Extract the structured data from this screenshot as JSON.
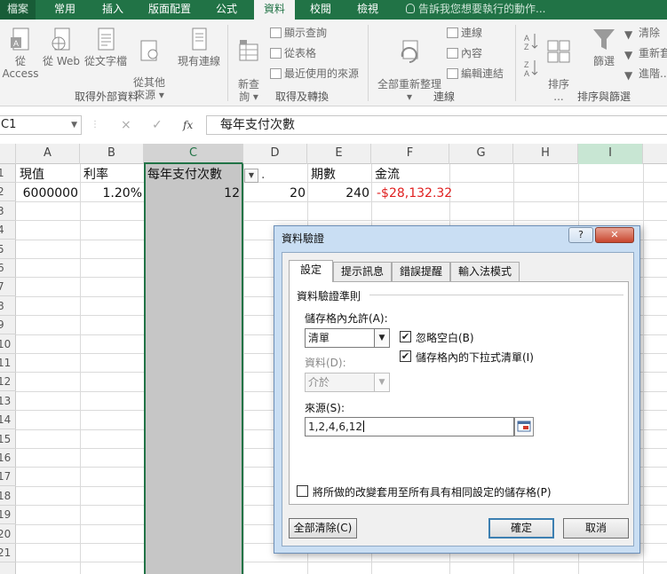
{
  "ribbon_tabs": [
    "檔案",
    "常用",
    "插入",
    "版面配置",
    "公式",
    "資料",
    "校閱",
    "檢視"
  ],
  "active_tab": "資料",
  "tell_me": "告訴我您想要執行的動作...",
  "ribbon": {
    "get_external": {
      "buttons": [
        "從 Access",
        "從 Web",
        "從文字檔",
        "從其他\n來源 ▾",
        "現有連線"
      ],
      "group_label": "取得外部資料"
    },
    "get_transform": {
      "new_query": "新查\n詢 ▾",
      "small": [
        "顯示查詢",
        "從表格",
        "最近使用的來源"
      ],
      "group_label": "取得及轉換"
    },
    "connections": {
      "refresh_all": "全部重新整理\n▾",
      "small": [
        "連線",
        "內容",
        "編輯連結"
      ],
      "group_label": "連線"
    },
    "sort_filter": {
      "sort": "排序\n...",
      "filter": "篩選",
      "small": [
        "清除",
        "重新套",
        "進階..."
      ],
      "group_label": "排序與篩選"
    }
  },
  "formula_bar": {
    "name_box": "C1",
    "cancel": "×",
    "enter": "✓",
    "fx": "fx",
    "content": "每年支付次數"
  },
  "columns": [
    "A",
    "B",
    "C",
    "D",
    "E",
    "F",
    "G",
    "H",
    "I"
  ],
  "rows": [
    "1",
    "2",
    "3",
    "4",
    "5",
    "6",
    "7",
    "8",
    "9",
    "10",
    "11",
    "12",
    "13",
    "14",
    "15",
    "16",
    "17",
    "18",
    "19",
    "20",
    "21"
  ],
  "cells": {
    "A1": "現值",
    "B1": "利率",
    "C1": "每年支付次數",
    "D1": ".",
    "E1": "期數",
    "F1": "金流",
    "A2": "6000000",
    "B2": "1.20%",
    "C2": "12",
    "D2": "20",
    "E2": "240",
    "F2": "-$28,132.32"
  },
  "dialog": {
    "title": "資料驗證",
    "help": "?",
    "close": "✕",
    "tabs": [
      "設定",
      "提示訊息",
      "錯誤提醒",
      "輸入法模式"
    ],
    "active_tab": "設定",
    "rule_section": "資料驗證準則",
    "allow_label": "儲存格內允許(A):",
    "allow_value": "清單",
    "ignore_blank": {
      "label": "忽略空白(B)",
      "checked": true
    },
    "in_cell_dropdown": {
      "label": "儲存格內的下拉式清單(I)",
      "checked": true
    },
    "data_label": "資料(D):",
    "data_value": "介於",
    "source_label": "來源(S):",
    "source_value": "1,2,4,6,12",
    "apply_all": {
      "label": "將所做的改變套用至所有具有相同設定的儲存格(P)",
      "checked": false
    },
    "clear_all": "全部清除(C)",
    "ok": "確定",
    "cancel": "取消"
  },
  "colors": {
    "excel_green": "#217346",
    "negative_red": "#e02020",
    "dialog_frame": "#c9def3"
  }
}
